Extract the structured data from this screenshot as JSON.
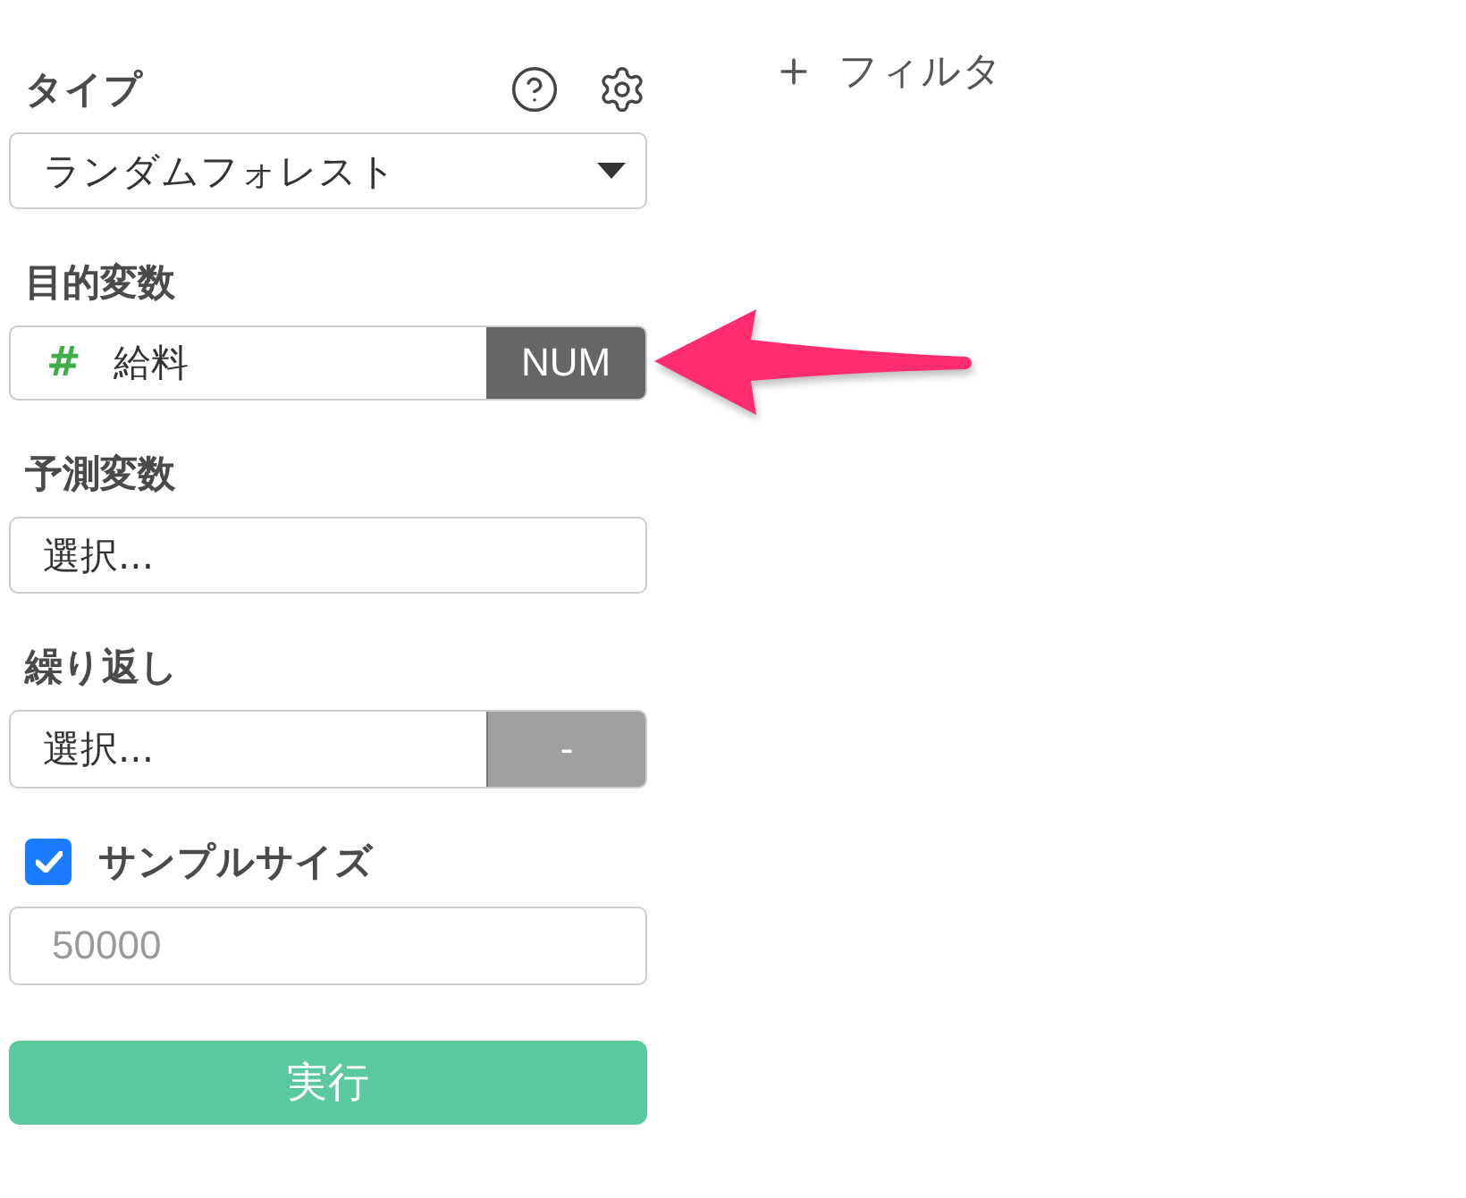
{
  "settings": {
    "type": {
      "label": "タイプ",
      "value": "ランダムフォレスト"
    },
    "target": {
      "label": "目的変数",
      "type_icon": "#",
      "value": "給料",
      "type_badge": "NUM"
    },
    "predictors": {
      "label": "予測変数",
      "placeholder": "選択..."
    },
    "repeat": {
      "label": "繰り返し",
      "placeholder": "選択...",
      "button": "-"
    },
    "sample_size": {
      "label": "サンプルサイズ",
      "checked": true,
      "placeholder": "50000"
    },
    "run_button": {
      "label": "実行"
    }
  },
  "filter_button": {
    "label": "フィルタ"
  }
}
